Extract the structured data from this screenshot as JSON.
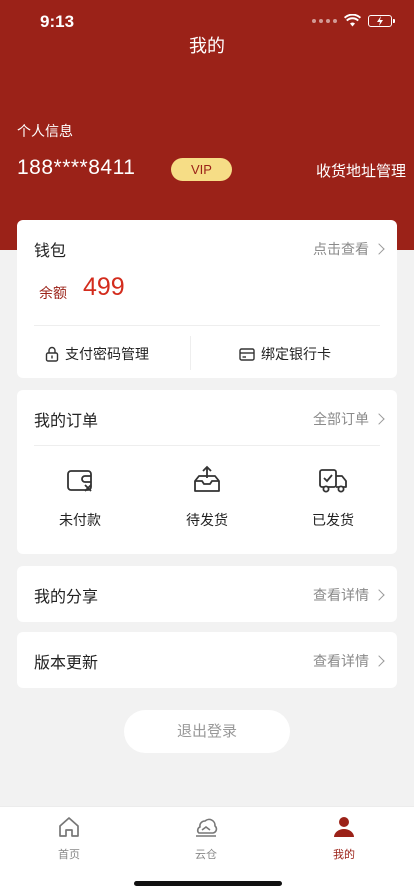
{
  "status_bar": {
    "time": "9:13"
  },
  "nav": {
    "title": "我的"
  },
  "profile": {
    "section_label": "个人信息",
    "phone": "188****8411",
    "badge": "VIP",
    "address_link": "收货地址管理"
  },
  "wallet": {
    "title": "钱包",
    "view_link": "点击查看",
    "balance_label": "余额",
    "balance_value": "499",
    "actions": [
      {
        "label": "支付密码管理",
        "icon": "lock-icon"
      },
      {
        "label": "绑定银行卡",
        "icon": "bank-card-icon"
      }
    ]
  },
  "orders": {
    "title": "我的订单",
    "all_link": "全部订单",
    "items": [
      {
        "label": "未付款",
        "icon": "unpaid-wallet-icon"
      },
      {
        "label": "待发货",
        "icon": "outbox-icon"
      },
      {
        "label": "已发货",
        "icon": "delivery-truck-icon"
      }
    ]
  },
  "share": {
    "title": "我的分享",
    "link": "查看详情"
  },
  "update": {
    "title": "版本更新",
    "link": "查看详情"
  },
  "logout": {
    "label": "退出登录"
  },
  "tabbar": {
    "items": [
      {
        "label": "首页",
        "icon": "home-icon",
        "active": false
      },
      {
        "label": "云仓",
        "icon": "cloud-warehouse-icon",
        "active": false
      },
      {
        "label": "我的",
        "icon": "user-icon",
        "active": true
      }
    ]
  },
  "colors": {
    "brand": "#9b2218",
    "balance": "#d32c1d",
    "vip_bg": "#f6dd86"
  }
}
